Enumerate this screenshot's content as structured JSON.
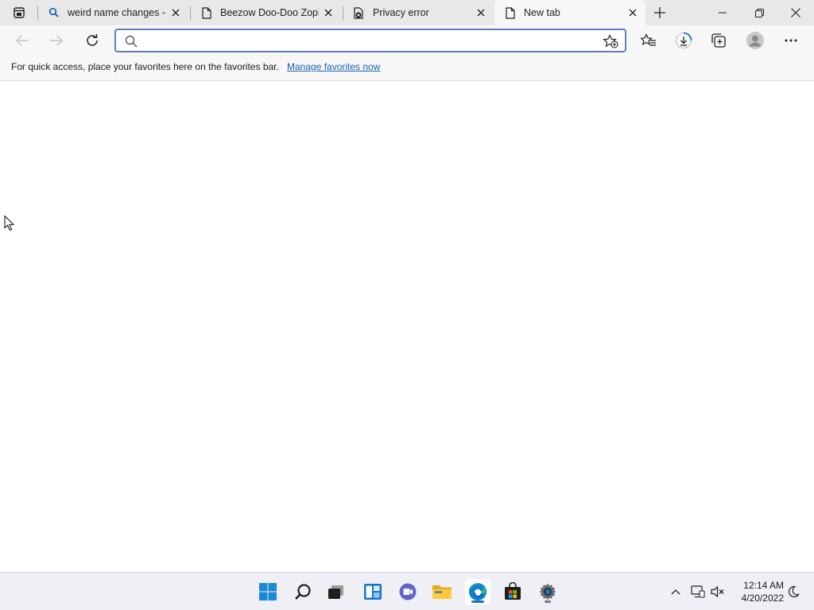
{
  "window": {
    "tabs": [
      {
        "title": "weird name changes - S",
        "favicon": "search-icon",
        "active": false
      },
      {
        "title": "Beezow Doo-Doo Zopit",
        "favicon": "page-icon",
        "active": false
      },
      {
        "title": "Privacy error",
        "favicon": "warning-page-icon",
        "active": false
      },
      {
        "title": "New tab",
        "favicon": "page-icon",
        "active": true
      }
    ],
    "controls": [
      "minimize",
      "restore",
      "close"
    ]
  },
  "toolbar": {
    "address": {
      "value": "",
      "placeholder": ""
    },
    "buttons": [
      "back-icon",
      "forward-icon",
      "refresh-icon",
      "favorites-icon",
      "downloads-icon",
      "collections-icon",
      "profile-icon",
      "more-icon"
    ]
  },
  "favorites_bar": {
    "message": "For quick access, place your favorites here on the favorites bar.",
    "link": "Manage favorites now"
  },
  "taskbar": {
    "apps": [
      "start-icon",
      "search-icon",
      "task-view-icon",
      "widgets-icon",
      "chat-icon",
      "file-explorer-icon",
      "edge-icon",
      "store-icon",
      "settings-icon"
    ],
    "active_app": "edge-icon",
    "tray": [
      "chevron-up-icon",
      "network-icon",
      "volume-muted-icon"
    ],
    "time": "12:14 AM",
    "date": "4/20/2022"
  },
  "colors": {
    "accent": "#1a5fb4",
    "tabstrip": "#e8e8e8",
    "toolbar": "#f7f7f7",
    "taskbar": "#eef0f5"
  }
}
